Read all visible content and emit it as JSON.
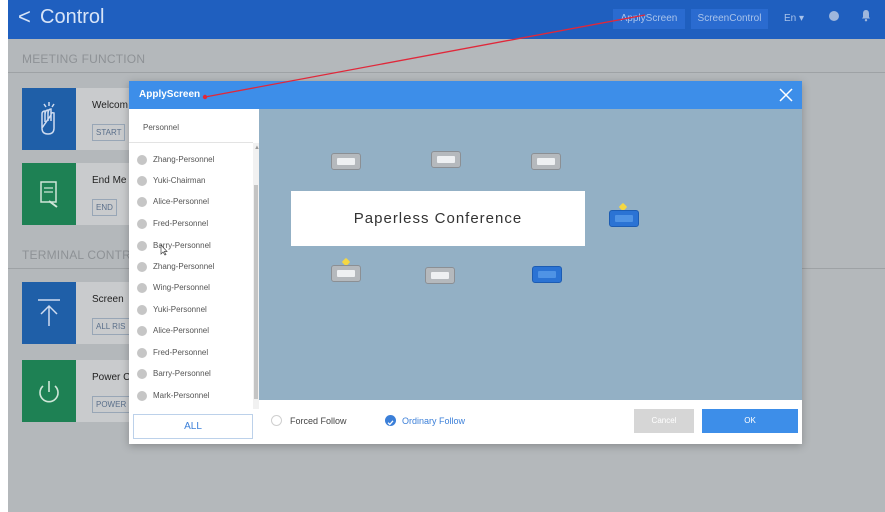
{
  "header": {
    "back_icon": "chevron-left-icon",
    "title": "Control",
    "apply_screen": "ApplyScreen",
    "screen_control": "ScreenControl",
    "language": "En ▾"
  },
  "sections": {
    "meeting": "MEETING FUNCTION",
    "terminal": "TERMINAL CONTR"
  },
  "cards": [
    {
      "title": "Welcom",
      "button": "START",
      "icon": "clap-icon"
    },
    {
      "title": "End Me",
      "button": "END",
      "icon": "sign-off-icon"
    },
    {
      "title": "Screen",
      "button": "ALL RIS",
      "icon": "upload-arrow-icon"
    },
    {
      "title": "Power C",
      "button": "POWER",
      "icon": "power-icon"
    }
  ],
  "modal": {
    "title": "ApplyScreen",
    "panel_title": "Personnel",
    "personnel": [
      "Zhang-Personnel",
      "Yuki-Chairman",
      "Alice-Personnel",
      "Fred-Personnel",
      "Barry-Personnel",
      "Zhang-Personnel",
      "Wing-Personnel",
      "Yuki-Personnel",
      "Alice-Personnel",
      "Fred-Personnel",
      "Barry-Personnel",
      "Mark-Personnel"
    ],
    "all_button": "ALL",
    "banner": "Paperless Conference",
    "forced_follow": "Forced Follow",
    "ordinary_follow": "Ordinary Follow",
    "cancel": "Cancel",
    "ok": "OK"
  },
  "colors": {
    "topbar": "#1f5fbf",
    "modal_accent": "#3d8ee9",
    "seat_area": "#93b0c5",
    "arrow": "#e0283a"
  }
}
